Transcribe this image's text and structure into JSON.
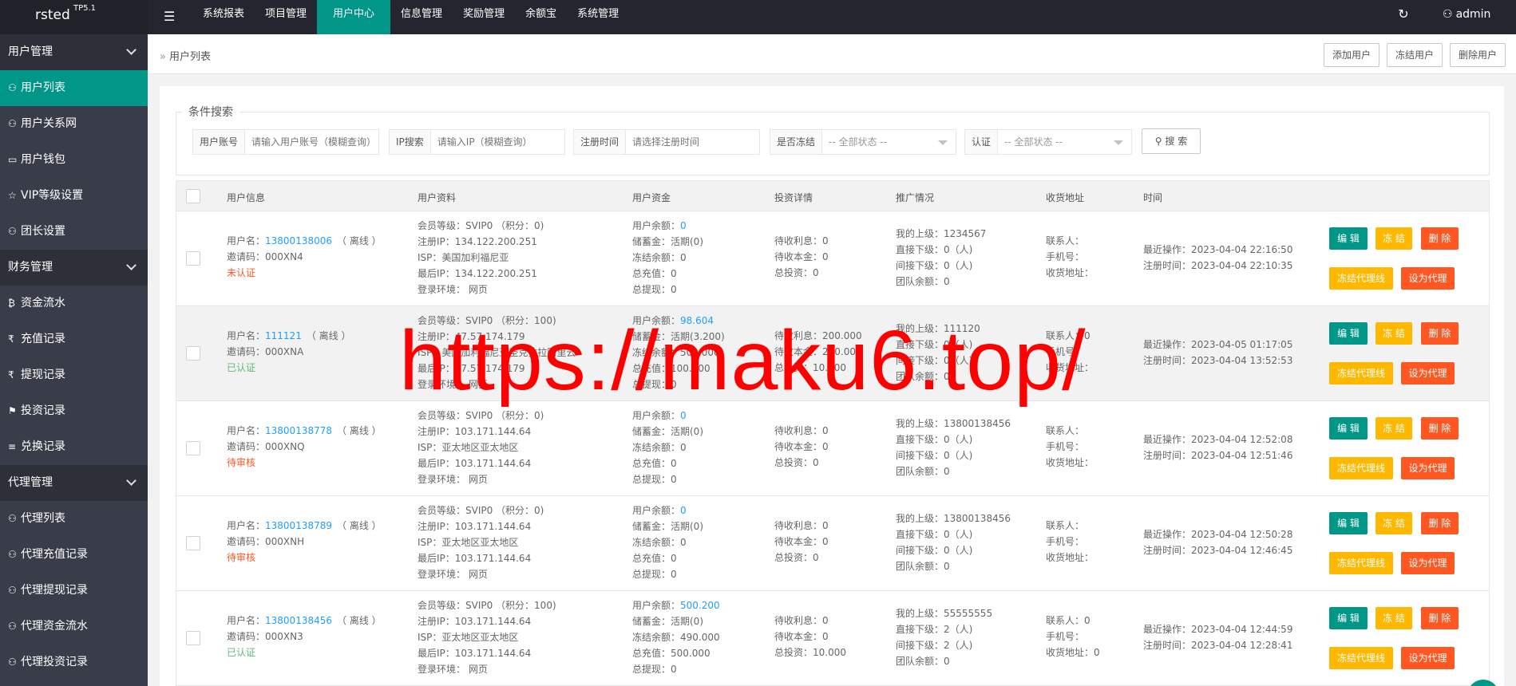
{
  "app": {
    "name": "rsted",
    "version": "TP5.1"
  },
  "topnav": {
    "menu_icon": "menu-icon",
    "items": [
      {
        "label": "系统报表",
        "active": false
      },
      {
        "label": "项目管理",
        "active": false
      },
      {
        "label": "用户中心",
        "active": true
      },
      {
        "label": "信息管理",
        "active": false
      },
      {
        "label": "奖励管理",
        "active": false
      },
      {
        "label": "余额宝",
        "active": false
      },
      {
        "label": "系统管理",
        "active": false
      }
    ],
    "refresh_icon": "refresh-icon",
    "user": "admin"
  },
  "sidebar": {
    "groups": [
      {
        "label": "用户管理",
        "items": [
          {
            "label": "用户列表",
            "icon": "user-icon",
            "active": true
          },
          {
            "label": "用户关系网",
            "icon": "user-icon",
            "active": false
          },
          {
            "label": "用户钱包",
            "icon": "wallet-icon",
            "active": false
          },
          {
            "label": "VIP等级设置",
            "icon": "star-icon",
            "active": false
          },
          {
            "label": "团长设置",
            "icon": "user-icon",
            "active": false
          }
        ]
      },
      {
        "label": "财务管理",
        "items": [
          {
            "label": "资金流水",
            "icon": "bitcoin-icon",
            "active": false
          },
          {
            "label": "充值记录",
            "icon": "rupee-icon",
            "active": false
          },
          {
            "label": "提现记录",
            "icon": "rupee-icon",
            "active": false
          },
          {
            "label": "投资记录",
            "icon": "flag-icon",
            "active": false
          },
          {
            "label": "兑换记录",
            "icon": "list-icon",
            "active": false
          }
        ]
      },
      {
        "label": "代理管理",
        "items": [
          {
            "label": "代理列表",
            "icon": "user-icon",
            "active": false
          },
          {
            "label": "代理充值记录",
            "icon": "user-icon",
            "active": false
          },
          {
            "label": "代理提现记录",
            "icon": "user-icon",
            "active": false
          },
          {
            "label": "代理资金流水",
            "icon": "user-icon",
            "active": false
          },
          {
            "label": "代理投资记录",
            "icon": "user-icon",
            "active": false
          }
        ]
      }
    ]
  },
  "breadcrumb": "用户列表",
  "toolbar": {
    "add": "添加用户",
    "freeze": "冻结用户",
    "delete": "删除用户"
  },
  "search": {
    "legend": "条件搜索",
    "account_label": "用户账号",
    "account_placeholder": "请输入用户账号（模糊查询）",
    "ip_label": "IP搜索",
    "ip_placeholder": "请输入IP（模糊查询）",
    "regtime_label": "注册时间",
    "regtime_placeholder": "请选择注册时间",
    "frozen_label": "是否冻结",
    "frozen_value": "-- 全部状态 --",
    "auth_label": "认证",
    "auth_value": "-- 全部状态 --",
    "button": "搜 索",
    "button_icon": "search-icon"
  },
  "table": {
    "headers": [
      "用户信息",
      "用户资料",
      "用户资金",
      "投资详情",
      "推广情况",
      "收货地址",
      "时间"
    ],
    "rows": [
      {
        "user": {
          "name_label": "用户名：",
          "name": "13800138006",
          "online": "（ 离线 ）",
          "invite": "邀请码：000XN4",
          "status": "未认证",
          "status_type": "red"
        },
        "profile": [
          "会员等级：SVIP0 （积分：0)",
          "注册IP：134.122.200.251",
          "ISP：美国加利福尼亚",
          "最后IP：134.122.200.251",
          "登录环境：  网页"
        ],
        "funds": {
          "balance_label": "用户余额：",
          "balance": "0",
          "lines": [
            "储蓄金：活期(0)",
            "冻结余额：0",
            "总充值：0",
            "总提现：0"
          ]
        },
        "invest": [
          "待收利息：0",
          "待收本金：0",
          "总投资：0"
        ],
        "promo": [
          "我的上级：1234567",
          "直接下级：0（人)",
          "间接下级：0（人)",
          "团队余额：0"
        ],
        "address": [
          "联系人：",
          "手机号：",
          "收货地址："
        ],
        "time": [
          "最近操作：2023-04-04 22:16:50",
          "注册时间：2023-04-04 22:10:35"
        ]
      },
      {
        "user": {
          "name_label": "用户名：",
          "name": "111121",
          "online": "（ 离线 ）",
          "invite": "邀请码：000XNA",
          "status": "已认证",
          "status_type": "green"
        },
        "profile": [
          "会员等级：SVIP0 （积分：100)",
          "注册IP：47.57.174.179",
          "ISP：美国加利福尼亚圣克拉拉阿里云",
          "最后IP：47.57.174.179",
          "登录环境：  网页"
        ],
        "funds": {
          "balance_label": "用户余额：",
          "balance": "98.604",
          "lines": [
            "储蓄金：活期(3.200)",
            "冻结余额：500.000",
            "总充值：100.000",
            "总提现：0"
          ]
        },
        "invest": [
          "待收利息：200.000",
          "待收本金：200.000",
          "总投资：10.000"
        ],
        "promo": [
          "我的上级：111120",
          "直接下级：0（人)",
          "间接下级：0（人)",
          "团队余额：0"
        ],
        "address": [
          "联系人：0",
          "手机号：",
          "收货地址："
        ],
        "time": [
          "最近操作：2023-04-05 01:17:05",
          "注册时间：2023-04-04 13:52:53"
        ]
      },
      {
        "user": {
          "name_label": "用户名：",
          "name": "13800138778",
          "online": "（ 离线 ）",
          "invite": "邀请码：000XNQ",
          "status": "待审核",
          "status_type": "red"
        },
        "profile": [
          "会员等级：SVIP0 （积分：0)",
          "注册IP：103.171.144.64",
          "ISP：亚太地区亚太地区",
          "最后IP：103.171.144.64",
          "登录环境：  网页"
        ],
        "funds": {
          "balance_label": "用户余额：",
          "balance": "0",
          "lines": [
            "储蓄金：活期(0)",
            "冻结余额：0",
            "总充值：0",
            "总提现：0"
          ]
        },
        "invest": [
          "待收利息：0",
          "待收本金：0",
          "总投资：0"
        ],
        "promo": [
          "我的上级：13800138456",
          "直接下级：0（人)",
          "间接下级：0（人)",
          "团队余额：0"
        ],
        "address": [
          "联系人：",
          "手机号：",
          "收货地址："
        ],
        "time": [
          "最近操作：2023-04-04 12:52:08",
          "注册时间：2023-04-04 12:51:46"
        ]
      },
      {
        "user": {
          "name_label": "用户名：",
          "name": "13800138789",
          "online": "（ 离线 ）",
          "invite": "邀请码：000XNH",
          "status": "待审核",
          "status_type": "red"
        },
        "profile": [
          "会员等级：SVIP0 （积分：0)",
          "注册IP：103.171.144.64",
          "ISP：亚太地区亚太地区",
          "最后IP：103.171.144.64",
          "登录环境：  网页"
        ],
        "funds": {
          "balance_label": "用户余额：",
          "balance": "0",
          "lines": [
            "储蓄金：活期(0)",
            "冻结余额：0",
            "总充值：0",
            "总提现：0"
          ]
        },
        "invest": [
          "待收利息：0",
          "待收本金：0",
          "总投资：0"
        ],
        "promo": [
          "我的上级：13800138456",
          "直接下级：0（人)",
          "间接下级：0（人)",
          "团队余额：0"
        ],
        "address": [
          "联系人：",
          "手机号：",
          "收货地址："
        ],
        "time": [
          "最近操作：2023-04-04 12:50:28",
          "注册时间：2023-04-04 12:46:45"
        ]
      },
      {
        "user": {
          "name_label": "用户名：",
          "name": "13800138456",
          "online": "（ 离线 ）",
          "invite": "邀请码：000XN3",
          "status": "已认证",
          "status_type": "green"
        },
        "profile": [
          "会员等级：SVIP0 （积分：100)",
          "注册IP：103.171.144.64",
          "ISP：亚太地区亚太地区",
          "最后IP：103.171.144.64",
          "登录环境：  网页"
        ],
        "funds": {
          "balance_label": "用户余额：",
          "balance": "500.200",
          "lines": [
            "储蓄金：活期(0)",
            "冻结余额：490.000",
            "总充值：500.000",
            "总提现：0"
          ]
        },
        "invest": [
          "待收利息：0",
          "待收本金：0",
          "总投资：10.000"
        ],
        "promo": [
          "我的上级：55555555",
          "直接下级：2（人)",
          "间接下级：2（人)",
          "团队余额：0"
        ],
        "address": [
          "联系人：0",
          "手机号：",
          "收货地址：0"
        ],
        "time": [
          "最近操作：2023-04-04 12:44:59",
          "注册时间：2023-04-04 12:28:41"
        ]
      }
    ],
    "actions": {
      "edit": "编 辑",
      "freeze": "冻 结",
      "delete": "删 除",
      "freeze_line": "冻结代理线",
      "set_agent": "设为代理"
    }
  },
  "watermark": "https://maku6.top/",
  "colors": {
    "accent": "#009688",
    "warn": "#ffb800",
    "danger": "#ff5722",
    "link": "#1e9fff",
    "dark": "#23262e",
    "sidebar": "#393d49"
  }
}
